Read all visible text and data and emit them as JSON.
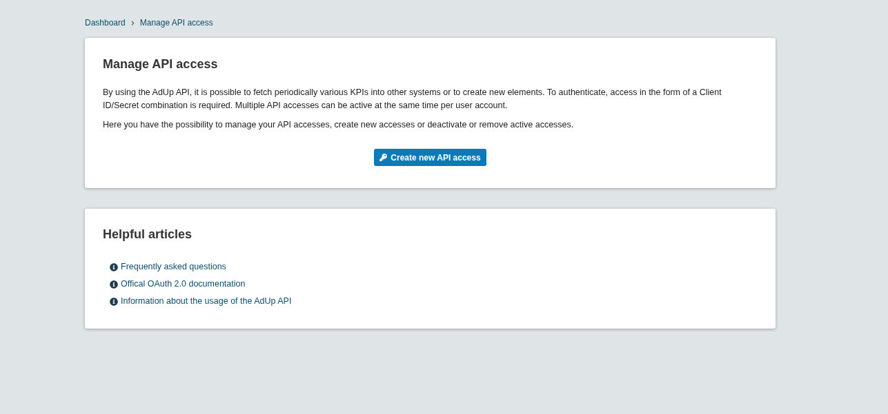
{
  "breadcrumb": [
    "Dashboard",
    "Manage API access"
  ],
  "access_card": {
    "title": "Manage API access",
    "paragraphs": [
      "By using the AdUp API, it is possible to fetch periodically various KPIs into other systems or to create new elements. To authenticate, access in the form of a Client ID/Secret combination is required. Multiple API accesses can be active at the same time per user account.",
      "Here you have the possibility to manage your API accesses, create new accesses or deactivate or remove active accesses."
    ],
    "button": "Create new API access"
  },
  "articles_card": {
    "title": "Helpful articles",
    "links": [
      "Frequently asked questions",
      "Offical OAuth 2.0 documentation",
      "Information about the usage of the AdUp API"
    ]
  }
}
